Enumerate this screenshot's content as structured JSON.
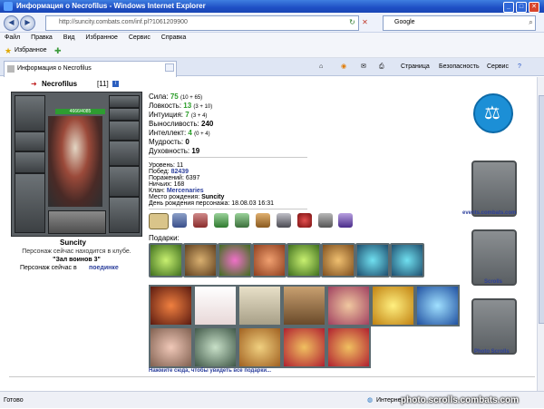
{
  "window": {
    "title": "Информация о Necrofilus - Windows Internet Explorer"
  },
  "address": {
    "url": "http://suncity.combats.com/inf.pl?1061209900",
    "search_placeholder": "Google"
  },
  "menu": [
    "Файл",
    "Правка",
    "Вид",
    "Избранное",
    "Сервис",
    "Справка"
  ],
  "favorites": {
    "label": "Избранное"
  },
  "tab": {
    "label": "Информация о Necrofilus"
  },
  "toolbar": {
    "page": "Страница",
    "security": "Безопасность",
    "service": "Сервис"
  },
  "character": {
    "name": "Necrofilus",
    "level": "[11]",
    "hp": "4666/4085",
    "city": "Suncity",
    "club_line": "Персонаж сейчас находится в клубе.",
    "hall": "\"Зал воинов 3\"",
    "fight_prefix": "Персонаж сейчас в",
    "fight_link": "поединке"
  },
  "stats": [
    {
      "name": "Сила:",
      "value": "75",
      "extra": "(10 + 65)"
    },
    {
      "name": "Ловкость:",
      "value": "13",
      "extra": "(3 + 10)"
    },
    {
      "name": "Интуиция:",
      "value": "7",
      "extra": "(3 + 4)"
    },
    {
      "name": "Выносливость:",
      "value": "240",
      "extra": ""
    },
    {
      "name": "Интеллект:",
      "value": "4",
      "extra": "(0 + 4)"
    },
    {
      "name": "Мудрость:",
      "value": "0",
      "extra": ""
    },
    {
      "name": "Духовность:",
      "value": "19",
      "extra": ""
    }
  ],
  "info": [
    {
      "label": "Уровень:",
      "value": "11"
    },
    {
      "label": "Побед:",
      "value": "82439"
    },
    {
      "label": "Поражений:",
      "value": "6397"
    },
    {
      "label": "Ничьих:",
      "value": "168"
    },
    {
      "label": "Клан:",
      "value": "Mercenaries"
    },
    {
      "label": "Место рождения:",
      "value": "Suncity"
    },
    {
      "label": "День рождения персонажа:",
      "value": "18.08.03 16:31"
    }
  ],
  "gifts": {
    "label": "Подарки:",
    "more_link": "Нажмите сюда, чтобы увидеть все подарки..."
  },
  "right_links": {
    "events": "events.combats.com",
    "scrolls": "Scrolls",
    "photo": "Photo Scrolls"
  },
  "status": {
    "done": "Готово",
    "zone": "Интернет",
    "watermark": "photo.scrolls.combats.com"
  },
  "colors": {
    "accent": "#1f4fc4",
    "stat_value": "#2a9d28",
    "link": "#2c3f9c"
  }
}
